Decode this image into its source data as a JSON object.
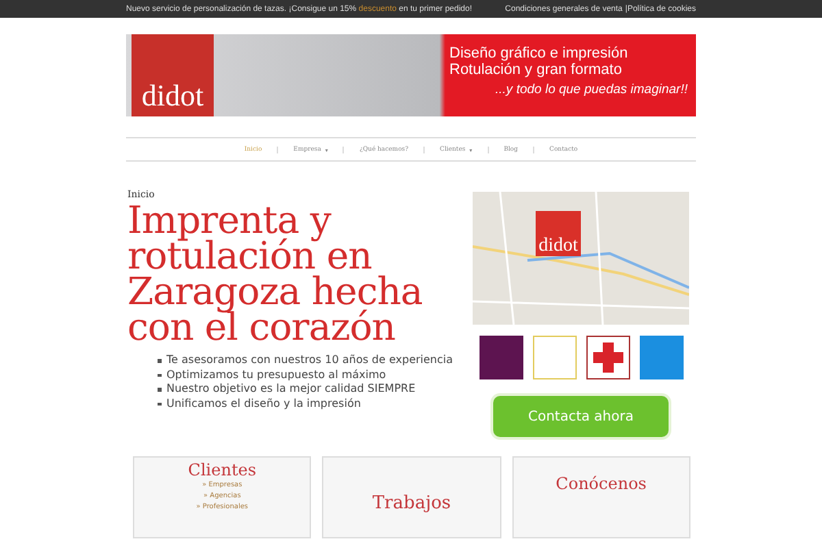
{
  "top_bar": {
    "promo_before": "Nuevo servicio de personalización de tazas. ¡Consigue un 15%",
    "promo_link": "descuento",
    "promo_after": "en tu primer pedido!",
    "links": [
      "Condiciones generales de venta",
      "|Política de cookies"
    ]
  },
  "banner": {
    "logo": "didot",
    "lines": [
      "Diseño gráfico e impresión",
      "Rotulación y gran formato"
    ],
    "slogan": "...y todo lo que puedas imaginar!!"
  },
  "nav": [
    {
      "label": "Inicio",
      "selected": true
    },
    {
      "label": "Empresa",
      "selected": false,
      "caret": "▾"
    },
    {
      "label": "¿Qué hacemos?",
      "selected": false
    },
    {
      "label": "Clientes",
      "selected": false,
      "caret": "▾"
    },
    {
      "label": "Blog",
      "selected": false
    },
    {
      "label": "Contacto",
      "selected": false
    }
  ],
  "breadcrumb": "Inicio",
  "headline": "Imprenta y rotulación en Zaragoza hecha con el corazón",
  "benefits": [
    "Te asesoramos con nuestros 10 años de experiencia",
    "Optimizamos tu presupuesto al máximo",
    "Nuestro objetivo es la mejor calidad SIEMPRE",
    "Unificamos el diseño y la impresión"
  ],
  "map": {
    "logo": "didot"
  },
  "client_logos": [
    {
      "kind": "purple"
    },
    {
      "kind": "government"
    },
    {
      "kind": "cross"
    },
    {
      "kind": "blue"
    }
  ],
  "cta_button": "Contacta ahora",
  "boxes": [
    {
      "title": "Clientes",
      "links": [
        "» Empresas",
        "» Agencias",
        "» Profesionales"
      ]
    },
    {
      "title": "Trabajos"
    },
    {
      "title": "Conócenos"
    }
  ]
}
